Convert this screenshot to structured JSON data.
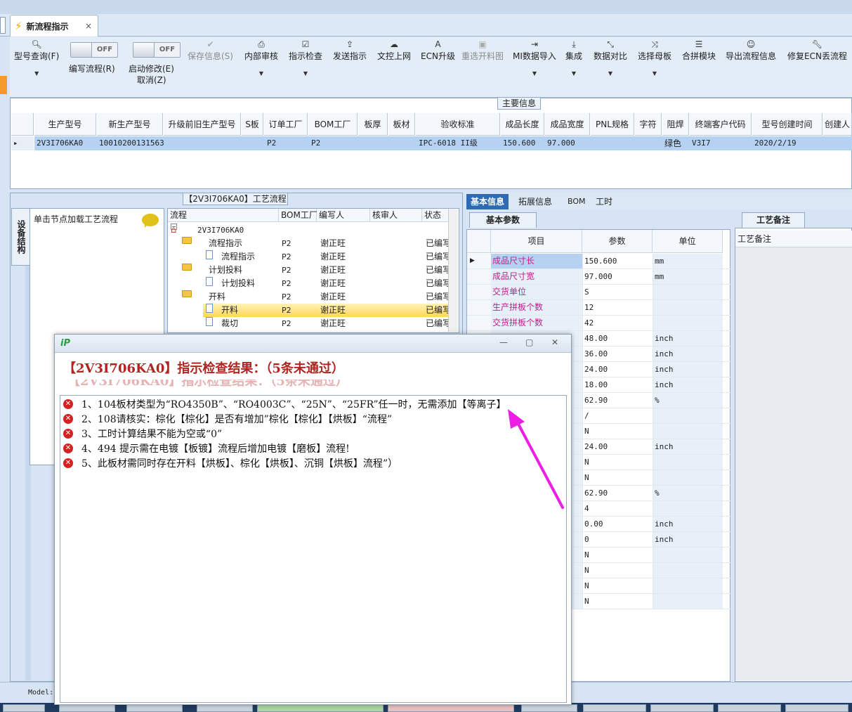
{
  "tab": {
    "title": "新流程指示",
    "close": "×"
  },
  "toolbar": {
    "query": "型号查询(F)",
    "edit_flow": "编写流程(R)",
    "start_modify": "启动修改(E)",
    "cancel": "取消(Z)",
    "toggle_off": "OFF",
    "save_info": "保存信息(S)",
    "internal_review": "内部审核",
    "instruction_check": "指示检查",
    "send_instruction": "发送指示",
    "upload_doc": "文控上网",
    "ecn_upgrade": "ECN升级",
    "reselect_cut": "重选开料图",
    "mi_import": "MI数据导入",
    "integrate": "集成",
    "data_compare": "数据对比",
    "select_master": "选择母板",
    "panel_module": "合拼模块",
    "export_flow": "导出流程信息",
    "repair_ecn": "修复ECN丢流程"
  },
  "main_info": {
    "title": "主要信息",
    "columns": [
      "生产型号",
      "新生产型号",
      "升级前旧生产型号",
      "S板",
      "订单工厂",
      "BOM工厂",
      "板厚",
      "板材",
      "验收标准",
      "成品长度",
      "成品宽度",
      "PNL规格",
      "字符",
      "阻焊",
      "终端客户代码",
      "型号创建时间",
      "创建人"
    ],
    "row": [
      "2V3I706KA0",
      "10010200131563",
      "",
      "",
      "P2",
      "P2",
      "",
      "",
      "IPC-6018 II级",
      "150.600",
      "97.000",
      "",
      "",
      "绿色",
      "V3I7",
      "2020/2/19",
      ""
    ]
  },
  "process": {
    "title": "【2V3I706KA0】工艺流程",
    "side_tab": "设备结构",
    "node_panel_label": "单击节点加载工艺流程",
    "columns": [
      "流程",
      "BOM工厂",
      "编写人",
      "核审人",
      "状态"
    ],
    "rows": [
      {
        "name": "2V3I706KA0",
        "bom": "",
        "writer": "",
        "status": ""
      },
      {
        "name": "流程指示",
        "bom": "P2",
        "writer": "谢正旺",
        "status": "已编写"
      },
      {
        "name": "流程指示",
        "bom": "P2",
        "writer": "谢正旺",
        "status": "已编写"
      },
      {
        "name": "计划投料",
        "bom": "P2",
        "writer": "谢正旺",
        "status": "已编写"
      },
      {
        "name": "计划投料",
        "bom": "P2",
        "writer": "谢正旺",
        "status": "已编写"
      },
      {
        "name": "开料",
        "bom": "P2",
        "writer": "谢正旺",
        "status": "已编写"
      },
      {
        "name": "开料",
        "bom": "P2",
        "writer": "谢正旺",
        "status": "已编写"
      },
      {
        "name": "裁切",
        "bom": "P2",
        "writer": "谢正旺",
        "status": "已编写"
      }
    ]
  },
  "right_tabs": [
    "基本信息",
    "拓展信息",
    "BOM",
    "工时"
  ],
  "basic_params": {
    "tab": "基本参数",
    "columns": [
      "项目",
      "参数",
      "单位"
    ],
    "rows": [
      {
        "item": "成品尺寸长",
        "value": "150.600",
        "unit": "mm"
      },
      {
        "item": "成品尺寸宽",
        "value": "97.000",
        "unit": "mm"
      },
      {
        "item": "交货单位",
        "value": "S",
        "unit": ""
      },
      {
        "item": "生产拼板个数",
        "value": "12",
        "unit": ""
      },
      {
        "item": "交货拼板个数",
        "value": "42",
        "unit": ""
      },
      {
        "item": "",
        "value": "48.00",
        "unit": "inch"
      },
      {
        "item": "",
        "value": "36.00",
        "unit": "inch"
      },
      {
        "item": "",
        "value": "24.00",
        "unit": "inch"
      },
      {
        "item": "",
        "value": "18.00",
        "unit": "inch"
      },
      {
        "item": "",
        "value": "62.90",
        "unit": "%"
      },
      {
        "item": "",
        "value": "/",
        "unit": ""
      },
      {
        "item": "",
        "value": "N",
        "unit": ""
      },
      {
        "item": "",
        "value": "24.00",
        "unit": "inch"
      },
      {
        "item": "",
        "value": "N",
        "unit": ""
      },
      {
        "item": "",
        "value": "N",
        "unit": ""
      },
      {
        "item": "",
        "value": "62.90",
        "unit": "%"
      },
      {
        "item": "",
        "value": "4",
        "unit": ""
      },
      {
        "item": "",
        "value": "0.00",
        "unit": "inch"
      },
      {
        "item": "",
        "value": "0",
        "unit": "inch"
      },
      {
        "item": "",
        "value": "N",
        "unit": ""
      },
      {
        "item": "",
        "value": "N",
        "unit": ""
      },
      {
        "item": "",
        "value": "N",
        "unit": ""
      },
      {
        "item": "",
        "value": "N",
        "unit": ""
      }
    ]
  },
  "remark": {
    "tab": "工艺备注",
    "header": "工艺备注"
  },
  "status": {
    "model_label": "Model:"
  },
  "dialog": {
    "heading": "【2V3I706KA0】指示检查结果：（5条未通过）",
    "ghost": "【2V3I706KA0】指示检查结果：（5条未通过）",
    "errors": [
      "1、104板材类型为“RO4350B”、“RO4003C”、“25N”、“25FR”任一时，无需添加【等离子】",
      "2、108请核实：棕化【棕化】是否有增加”棕化【棕化】【烘板】“流程”",
      "3、工时计算结果不能为空或“0”",
      "4、494 提示需在电镀【板镀】流程后增加电镀【磨板】流程!",
      "5、此板材需同时存在开料【烘板】、棕化【烘板】、沉铜【烘板】流程”）"
    ]
  },
  "colors": {
    "error_red": "#b0251f",
    "arrow_magenta": "#ee1ee6",
    "selected_row": "#b6d2f3"
  }
}
